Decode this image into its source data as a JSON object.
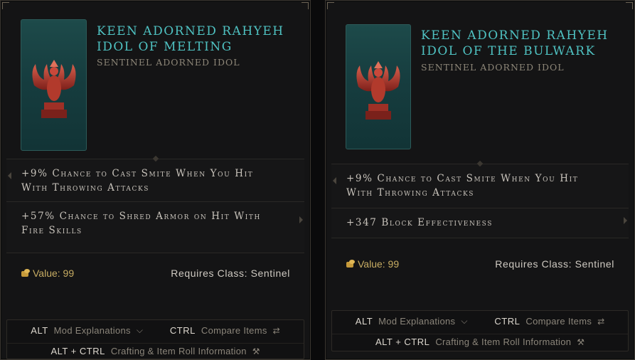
{
  "items": [
    {
      "title_line1": "Keen Adorned Rahyeh",
      "title_line2": "Idol of Melting",
      "subtitle": "Sentinel Adorned Idol",
      "affixes": [
        {
          "line1": "+9% Chance to Cast Smite When You Hit",
          "line2": "With Throwing Attacks"
        },
        {
          "line1": "+57% Chance to Shred Armor on Hit With",
          "line2": "Fire Skills"
        }
      ],
      "value_label": "Value: 99",
      "requirement": "Requires Class: Sentinel"
    },
    {
      "title_line1": "Keen Adorned Rahyeh",
      "title_line2": "Idol of the Bulwark",
      "subtitle": "Sentinel Adorned Idol",
      "affixes": [
        {
          "line1": "+9% Chance to Cast Smite When You Hit",
          "line2": "With Throwing Attacks"
        },
        {
          "line1": "+347 Block Effectiveness",
          "line2": ""
        }
      ],
      "value_label": "Value: 99",
      "requirement": "Requires Class: Sentinel"
    }
  ],
  "hotkeys": {
    "alt_key": "ALT",
    "alt_desc": "Mod Explanations",
    "ctrl_key": "CTRL",
    "ctrl_desc": "Compare Items",
    "altctrl_key": "ALT + CTRL",
    "altctrl_desc": "Crafting & Item Roll Information"
  },
  "icons": {
    "art": "rahyeh-phoenix-idol-icon",
    "value": "gold-coins-icon",
    "chevron": "chevron-down-icon",
    "compare": "compare-arrows-icon",
    "craft": "hammer-icon"
  },
  "colors": {
    "title": "#4fc2c2",
    "subtitle": "#8d8678",
    "affix_text": "#c8c3bb",
    "gold": "#c8ad63",
    "art_bg": "#1d4a4a"
  }
}
